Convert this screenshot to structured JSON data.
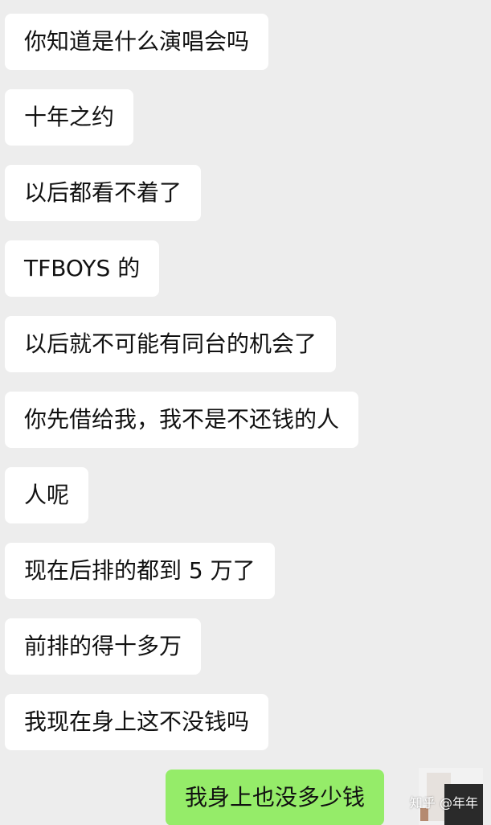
{
  "messages": [
    {
      "side": "incoming",
      "text": "你知道是什么演唱会吗"
    },
    {
      "side": "incoming",
      "text": "十年之约"
    },
    {
      "side": "incoming",
      "text": "以后都看不着了"
    },
    {
      "side": "incoming",
      "text": "TFBOYS 的"
    },
    {
      "side": "incoming",
      "text": "以后就不可能有同台的机会了"
    },
    {
      "side": "incoming",
      "text": "你先借给我，我不是不还钱的人"
    },
    {
      "side": "incoming",
      "text": "人呢"
    },
    {
      "side": "incoming",
      "text": "现在后排的都到 5 万了"
    },
    {
      "side": "incoming",
      "text": "前排的得十多万"
    },
    {
      "side": "incoming",
      "text": "我现在身上这不没钱吗"
    },
    {
      "side": "outgoing",
      "text": "我身上也没多少钱"
    }
  ],
  "watermark": "知乎 @年年",
  "colors": {
    "background": "#ededed",
    "incoming_bubble": "#ffffff",
    "outgoing_bubble": "#95ec69",
    "text": "#111111"
  }
}
